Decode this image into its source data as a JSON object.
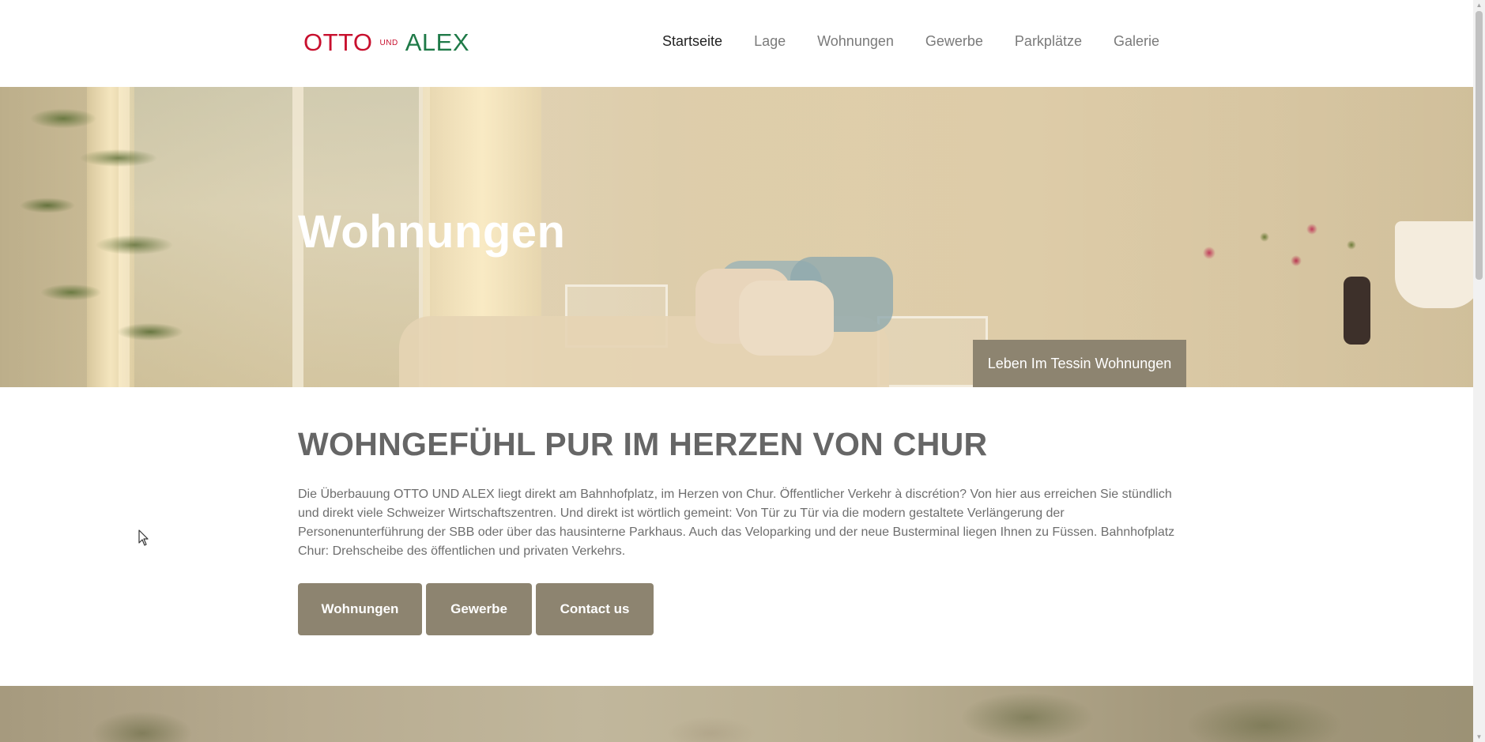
{
  "header": {
    "logo": {
      "otto": "OTTO",
      "und": "UND",
      "alex": "ALEX"
    },
    "nav": [
      {
        "label": "Startseite",
        "active": true
      },
      {
        "label": "Lage",
        "active": false
      },
      {
        "label": "Wohnungen",
        "active": false
      },
      {
        "label": "Gewerbe",
        "active": false
      },
      {
        "label": "Parkplätze",
        "active": false
      },
      {
        "label": "Galerie",
        "active": false
      }
    ]
  },
  "hero": {
    "title": "Wohnungen",
    "tag": "Leben Im Tessin Wohnungen"
  },
  "main": {
    "heading": "WOHNGEFÜHL PUR IM HERZEN VON CHUR",
    "paragraph": "Die Überbauung OTTO UND ALEX liegt direkt am Bahnhofplatz, im Herzen von Chur. Öffentlicher Verkehr à discrétion? Von hier aus erreichen Sie stündlich und direkt viele Schweizer Wirtschaftszentren. Und direkt ist wörtlich gemeint: Von Tür zu Tür via die modern gestaltete Verlängerung der Personenunterführung der SBB oder über das hausinterne Parkhaus. Auch das Veloparking und der neue Busterminal liegen Ihnen zu Füssen. Bahnhofplatz Chur: Drehscheibe des öffentlichen und privaten Verkehrs.",
    "buttons": [
      {
        "label": "Wohnungen"
      },
      {
        "label": "Gewerbe"
      },
      {
        "label": "Contact us"
      }
    ]
  },
  "colors": {
    "brand_red": "#c8102e",
    "brand_green": "#1f7a48",
    "button_bg": "#8d8470",
    "heading_text": "#666666"
  },
  "icons": {
    "scroll_up": "▲",
    "scroll_down": "▼"
  }
}
